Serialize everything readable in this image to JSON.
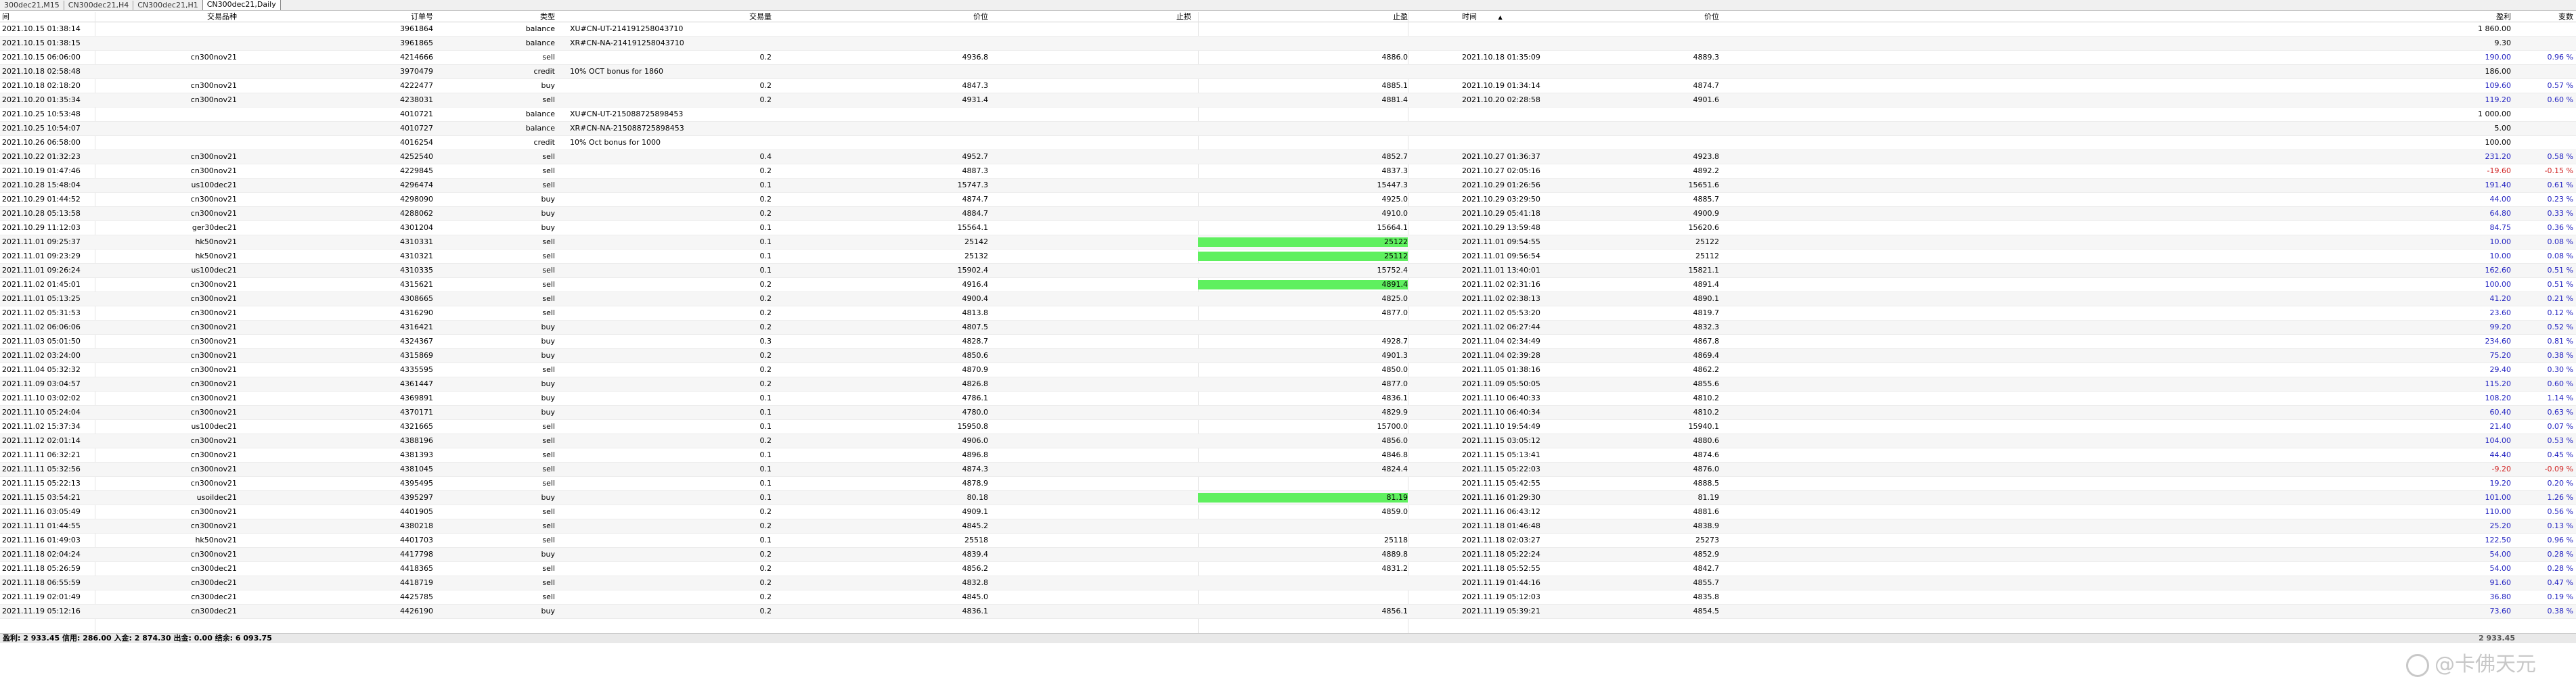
{
  "tabs": [
    "300dec21,M15",
    "CN300dec21,H4",
    "CN300dec21,H1",
    "CN300dec21,Daily"
  ],
  "columns": {
    "open_time": "间",
    "symbol": "交易品种",
    "ticket": "订单号",
    "type": "类型",
    "volume": "交易量",
    "price": "价位",
    "sl": "止损",
    "tp": "止盈",
    "close_time": "时间",
    "close_time_arrow": "▲",
    "close_price": "价位",
    "profit": "盈利",
    "change": "变数"
  },
  "rows": [
    {
      "open": "2021.10.15 01:38:14",
      "sym": "",
      "tk": "3961864",
      "type": "balance",
      "vol": "XU#CN-UT-214191258043710",
      "price": "",
      "sl": "",
      "tp": "",
      "ct": "",
      "cp": "",
      "profit": "1 860.00",
      "chg": ""
    },
    {
      "open": "2021.10.15 01:38:15",
      "sym": "",
      "tk": "3961865",
      "type": "balance",
      "vol": "XR#CN-NA-214191258043710",
      "price": "",
      "sl": "",
      "tp": "",
      "ct": "",
      "cp": "",
      "profit": "9.30",
      "chg": ""
    },
    {
      "open": "2021.10.15 06:06:00",
      "sym": "cn300nov21",
      "tk": "4214666",
      "type": "sell",
      "vol": "0.2",
      "price": "4936.8",
      "sl": "",
      "tp": "4886.0",
      "ct": "2021.10.18 01:35:09",
      "cp": "4889.3",
      "profit": "190.00",
      "chg": "0.96 %"
    },
    {
      "open": "2021.10.18 02:58:48",
      "sym": "",
      "tk": "3970479",
      "type": "credit",
      "vol": "10% OCT bonus for 1860",
      "price": "",
      "sl": "",
      "tp": "",
      "ct": "",
      "cp": "",
      "profit": "186.00",
      "chg": ""
    },
    {
      "open": "2021.10.18 02:18:20",
      "sym": "cn300nov21",
      "tk": "4222477",
      "type": "buy",
      "vol": "0.2",
      "price": "4847.3",
      "sl": "",
      "tp": "4885.1",
      "ct": "2021.10.19 01:34:14",
      "cp": "4874.7",
      "profit": "109.60",
      "chg": "0.57 %"
    },
    {
      "open": "2021.10.20 01:35:34",
      "sym": "cn300nov21",
      "tk": "4238031",
      "type": "sell",
      "vol": "0.2",
      "price": "4931.4",
      "sl": "",
      "tp": "4881.4",
      "ct": "2021.10.20 02:28:58",
      "cp": "4901.6",
      "profit": "119.20",
      "chg": "0.60 %"
    },
    {
      "open": "2021.10.25 10:53:48",
      "sym": "",
      "tk": "4010721",
      "type": "balance",
      "vol": "XU#CN-UT-215088725898453",
      "price": "",
      "sl": "",
      "tp": "",
      "ct": "",
      "cp": "",
      "profit": "1 000.00",
      "chg": ""
    },
    {
      "open": "2021.10.25 10:54:07",
      "sym": "",
      "tk": "4010727",
      "type": "balance",
      "vol": "XR#CN-NA-215088725898453",
      "price": "",
      "sl": "",
      "tp": "",
      "ct": "",
      "cp": "",
      "profit": "5.00",
      "chg": ""
    },
    {
      "open": "2021.10.26 06:58:00",
      "sym": "",
      "tk": "4016254",
      "type": "credit",
      "vol": "10% Oct bonus for 1000",
      "price": "",
      "sl": "",
      "tp": "",
      "ct": "",
      "cp": "",
      "profit": "100.00",
      "chg": ""
    },
    {
      "open": "2021.10.22 01:32:23",
      "sym": "cn300nov21",
      "tk": "4252540",
      "type": "sell",
      "vol": "0.4",
      "price": "4952.7",
      "sl": "",
      "tp": "4852.7",
      "ct": "2021.10.27 01:36:37",
      "cp": "4923.8",
      "profit": "231.20",
      "chg": "0.58 %"
    },
    {
      "open": "2021.10.19 01:47:46",
      "sym": "cn300nov21",
      "tk": "4229845",
      "type": "sell",
      "vol": "0.2",
      "price": "4887.3",
      "sl": "",
      "tp": "4837.3",
      "ct": "2021.10.27 02:05:16",
      "cp": "4892.2",
      "profit": "-19.60",
      "chg": "-0.15 %"
    },
    {
      "open": "2021.10.28 15:48:04",
      "sym": "us100dec21",
      "tk": "4296474",
      "type": "sell",
      "vol": "0.1",
      "price": "15747.3",
      "sl": "",
      "tp": "15447.3",
      "ct": "2021.10.29 01:26:56",
      "cp": "15651.6",
      "profit": "191.40",
      "chg": "0.61 %"
    },
    {
      "open": "2021.10.29 01:44:52",
      "sym": "cn300nov21",
      "tk": "4298090",
      "type": "buy",
      "vol": "0.2",
      "price": "4874.7",
      "sl": "",
      "tp": "4925.0",
      "ct": "2021.10.29 03:29:50",
      "cp": "4885.7",
      "profit": "44.00",
      "chg": "0.23 %"
    },
    {
      "open": "2021.10.28 05:13:58",
      "sym": "cn300nov21",
      "tk": "4288062",
      "type": "buy",
      "vol": "0.2",
      "price": "4884.7",
      "sl": "",
      "tp": "4910.0",
      "ct": "2021.10.29 05:41:18",
      "cp": "4900.9",
      "profit": "64.80",
      "chg": "0.33 %"
    },
    {
      "open": "2021.10.29 11:12:03",
      "sym": "ger30dec21",
      "tk": "4301204",
      "type": "buy",
      "vol": "0.1",
      "price": "15564.1",
      "sl": "",
      "tp": "15664.1",
      "ct": "2021.10.29 13:59:48",
      "cp": "15620.6",
      "profit": "84.75",
      "chg": "0.36 %"
    },
    {
      "open": "2021.11.01 09:25:37",
      "sym": "hk50nov21",
      "tk": "4310331",
      "type": "sell",
      "vol": "0.1",
      "price": "25142",
      "sl": "",
      "tp": "25122",
      "tpg": true,
      "ct": "2021.11.01 09:54:55",
      "cp": "25122",
      "profit": "10.00",
      "chg": "0.08 %"
    },
    {
      "open": "2021.11.01 09:23:29",
      "sym": "hk50nov21",
      "tk": "4310321",
      "type": "sell",
      "vol": "0.1",
      "price": "25132",
      "sl": "",
      "tp": "25112",
      "tpg": true,
      "ct": "2021.11.01 09:56:54",
      "cp": "25112",
      "profit": "10.00",
      "chg": "0.08 %"
    },
    {
      "open": "2021.11.01 09:26:24",
      "sym": "us100dec21",
      "tk": "4310335",
      "type": "sell",
      "vol": "0.1",
      "price": "15902.4",
      "sl": "",
      "tp": "15752.4",
      "ct": "2021.11.01 13:40:01",
      "cp": "15821.1",
      "profit": "162.60",
      "chg": "0.51 %"
    },
    {
      "open": "2021.11.02 01:45:01",
      "sym": "cn300nov21",
      "tk": "4315621",
      "type": "sell",
      "vol": "0.2",
      "price": "4916.4",
      "sl": "",
      "tp": "4891.4",
      "tpg": true,
      "ct": "2021.11.02 02:31:16",
      "cp": "4891.4",
      "profit": "100.00",
      "chg": "0.51 %"
    },
    {
      "open": "2021.11.01 05:13:25",
      "sym": "cn300nov21",
      "tk": "4308665",
      "type": "sell",
      "vol": "0.2",
      "price": "4900.4",
      "sl": "",
      "tp": "4825.0",
      "ct": "2021.11.02 02:38:13",
      "cp": "4890.1",
      "profit": "41.20",
      "chg": "0.21 %"
    },
    {
      "open": "2021.11.02 05:31:53",
      "sym": "cn300nov21",
      "tk": "4316290",
      "type": "sell",
      "vol": "0.2",
      "price": "4813.8",
      "sl": "",
      "tp": "4877.0",
      "ct": "2021.11.02 05:53:20",
      "cp": "4819.7",
      "profit": "23.60",
      "chg": "0.12 %"
    },
    {
      "open": "2021.11.02 06:06:06",
      "sym": "cn300nov21",
      "tk": "4316421",
      "type": "buy",
      "vol": "0.2",
      "price": "4807.5",
      "sl": "",
      "tp": "",
      "ct": "2021.11.02 06:27:44",
      "cp": "4832.3",
      "profit": "99.20",
      "chg": "0.52 %"
    },
    {
      "open": "2021.11.03 05:01:50",
      "sym": "cn300nov21",
      "tk": "4324367",
      "type": "buy",
      "vol": "0.3",
      "price": "4828.7",
      "sl": "",
      "tp": "4928.7",
      "ct": "2021.11.04 02:34:49",
      "cp": "4867.8",
      "profit": "234.60",
      "chg": "0.81 %"
    },
    {
      "open": "2021.11.02 03:24:00",
      "sym": "cn300nov21",
      "tk": "4315869",
      "type": "buy",
      "vol": "0.2",
      "price": "4850.6",
      "sl": "",
      "tp": "4901.3",
      "ct": "2021.11.04 02:39:28",
      "cp": "4869.4",
      "profit": "75.20",
      "chg": "0.38 %"
    },
    {
      "open": "2021.11.04 05:32:32",
      "sym": "cn300nov21",
      "tk": "4335595",
      "type": "sell",
      "vol": "0.2",
      "price": "4870.9",
      "sl": "",
      "tp": "4850.0",
      "ct": "2021.11.05 01:38:16",
      "cp": "4862.2",
      "profit": "29.40",
      "chg": "0.30 %"
    },
    {
      "open": "2021.11.09 03:04:57",
      "sym": "cn300nov21",
      "tk": "4361447",
      "type": "buy",
      "vol": "0.2",
      "price": "4826.8",
      "sl": "",
      "tp": "4877.0",
      "ct": "2021.11.09 05:50:05",
      "cp": "4855.6",
      "profit": "115.20",
      "chg": "0.60 %"
    },
    {
      "open": "2021.11.10 03:02:02",
      "sym": "cn300nov21",
      "tk": "4369891",
      "type": "buy",
      "vol": "0.1",
      "price": "4786.1",
      "sl": "",
      "tp": "4836.1",
      "ct": "2021.11.10 06:40:33",
      "cp": "4810.2",
      "profit": "108.20",
      "chg": "1.14 %"
    },
    {
      "open": "2021.11.10 05:24:04",
      "sym": "cn300nov21",
      "tk": "4370171",
      "type": "buy",
      "vol": "0.1",
      "price": "4780.0",
      "sl": "",
      "tp": "4829.9",
      "ct": "2021.11.10 06:40:34",
      "cp": "4810.2",
      "profit": "60.40",
      "chg": "0.63 %"
    },
    {
      "open": "2021.11.02 15:37:34",
      "sym": "us100dec21",
      "tk": "4321665",
      "type": "sell",
      "vol": "0.1",
      "price": "15950.8",
      "sl": "",
      "tp": "15700.0",
      "ct": "2021.11.10 19:54:49",
      "cp": "15940.1",
      "profit": "21.40",
      "chg": "0.07 %"
    },
    {
      "open": "2021.11.12 02:01:14",
      "sym": "cn300nov21",
      "tk": "4388196",
      "type": "sell",
      "vol": "0.2",
      "price": "4906.0",
      "sl": "",
      "tp": "4856.0",
      "ct": "2021.11.15 03:05:12",
      "cp": "4880.6",
      "profit": "104.00",
      "chg": "0.53 %"
    },
    {
      "open": "2021.11.11 06:32:21",
      "sym": "cn300nov21",
      "tk": "4381393",
      "type": "sell",
      "vol": "0.1",
      "price": "4896.8",
      "sl": "",
      "tp": "4846.8",
      "ct": "2021.11.15 05:13:41",
      "cp": "4874.6",
      "profit": "44.40",
      "chg": "0.45 %"
    },
    {
      "open": "2021.11.11 05:32:56",
      "sym": "cn300nov21",
      "tk": "4381045",
      "type": "sell",
      "vol": "0.1",
      "price": "4874.3",
      "sl": "",
      "tp": "4824.4",
      "ct": "2021.11.15 05:22:03",
      "cp": "4876.0",
      "profit": "-9.20",
      "chg": "-0.09 %"
    },
    {
      "open": "2021.11.15 05:22:13",
      "sym": "cn300nov21",
      "tk": "4395495",
      "type": "sell",
      "vol": "0.1",
      "price": "4878.9",
      "sl": "",
      "tp": "",
      "ct": "2021.11.15 05:42:55",
      "cp": "4888.5",
      "profit": "19.20",
      "chg": "0.20 %"
    },
    {
      "open": "2021.11.15 03:54:21",
      "sym": "usoildec21",
      "tk": "4395297",
      "type": "buy",
      "vol": "0.1",
      "price": "80.18",
      "sl": "",
      "tp": "81.19",
      "tpg": true,
      "ct": "2021.11.16 01:29:30",
      "cp": "81.19",
      "profit": "101.00",
      "chg": "1.26 %"
    },
    {
      "open": "2021.11.16 03:05:49",
      "sym": "cn300nov21",
      "tk": "4401905",
      "type": "sell",
      "vol": "0.2",
      "price": "4909.1",
      "sl": "",
      "tp": "4859.0",
      "ct": "2021.11.16 06:43:12",
      "cp": "4881.6",
      "profit": "110.00",
      "chg": "0.56 %"
    },
    {
      "open": "2021.11.11 01:44:55",
      "sym": "cn300nov21",
      "tk": "4380218",
      "type": "sell",
      "vol": "0.2",
      "price": "4845.2",
      "sl": "",
      "tp": "",
      "ct": "2021.11.18 01:46:48",
      "cp": "4838.9",
      "profit": "25.20",
      "chg": "0.13 %"
    },
    {
      "open": "2021.11.16 01:49:03",
      "sym": "hk50nov21",
      "tk": "4401703",
      "type": "sell",
      "vol": "0.1",
      "price": "25518",
      "sl": "",
      "tp": "25118",
      "ct": "2021.11.18 02:03:27",
      "cp": "25273",
      "profit": "122.50",
      "chg": "0.96 %"
    },
    {
      "open": "2021.11.18 02:04:24",
      "sym": "cn300nov21",
      "tk": "4417798",
      "type": "buy",
      "vol": "0.2",
      "price": "4839.4",
      "sl": "",
      "tp": "4889.8",
      "ct": "2021.11.18 05:22:24",
      "cp": "4852.9",
      "profit": "54.00",
      "chg": "0.28 %"
    },
    {
      "open": "2021.11.18 05:26:59",
      "sym": "cn300dec21",
      "tk": "4418365",
      "type": "sell",
      "vol": "0.2",
      "price": "4856.2",
      "sl": "",
      "tp": "4831.2",
      "ct": "2021.11.18 05:52:55",
      "cp": "4842.7",
      "profit": "54.00",
      "chg": "0.28 %"
    },
    {
      "open": "2021.11.18 06:55:59",
      "sym": "cn300dec21",
      "tk": "4418719",
      "type": "sell",
      "vol": "0.2",
      "price": "4832.8",
      "sl": "",
      "tp": "",
      "ct": "2021.11.19 01:44:16",
      "cp": "4855.7",
      "profit": "91.60",
      "chg": "0.47 %"
    },
    {
      "open": "2021.11.19 02:01:49",
      "sym": "cn300dec21",
      "tk": "4425785",
      "type": "sell",
      "vol": "0.2",
      "price": "4845.0",
      "sl": "",
      "tp": "",
      "ct": "2021.11.19 05:12:03",
      "cp": "4835.8",
      "profit": "36.80",
      "chg": "0.19 %"
    },
    {
      "open": "2021.11.19 05:12:16",
      "sym": "cn300dec21",
      "tk": "4426190",
      "type": "buy",
      "vol": "0.2",
      "price": "4836.1",
      "sl": "",
      "tp": "4856.1",
      "ct": "2021.11.19 05:39:21",
      "cp": "4854.5",
      "profit": "73.60",
      "chg": "0.38 %"
    }
  ],
  "footer": {
    "summary": "盈利: 2 933.45  信用: 286.00  入金: 2 874.30  出金: 0.00  结余: 6 093.75",
    "total": "2 933.45"
  },
  "watermark": "@卡佛天元"
}
